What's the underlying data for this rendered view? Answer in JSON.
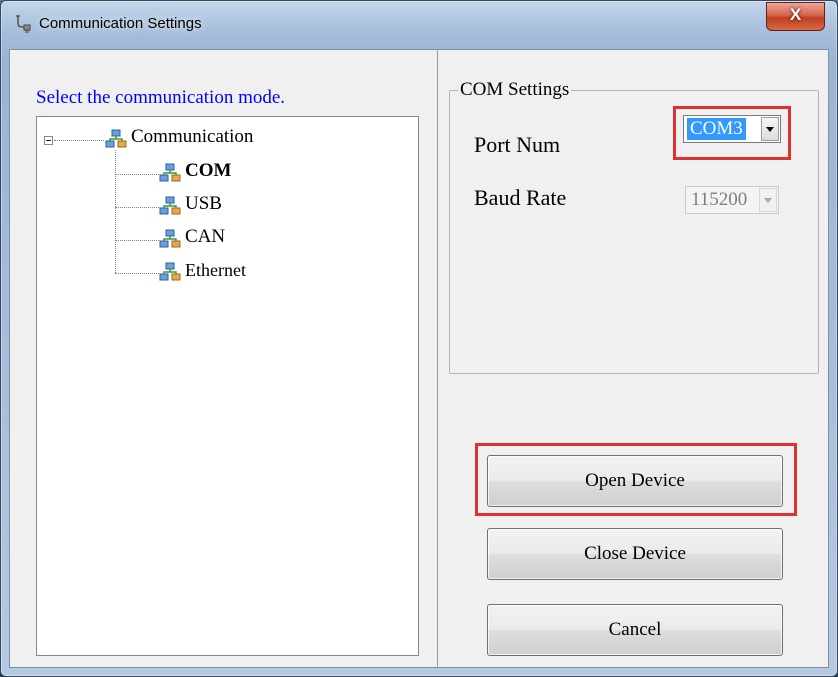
{
  "window": {
    "title": "Communication Settings",
    "close_label": "X"
  },
  "left_panel": {
    "instruction": "Select the communication mode.",
    "tree": {
      "root": "Communication",
      "children": [
        {
          "label": "COM",
          "selected": true
        },
        {
          "label": "USB",
          "selected": false
        },
        {
          "label": "CAN",
          "selected": false
        },
        {
          "label": "Ethernet",
          "selected": false
        }
      ]
    }
  },
  "com_settings": {
    "group_title": "COM Settings",
    "port_label": "Port Num",
    "port_value": "COM3",
    "baud_label": "Baud Rate",
    "baud_value": "115200"
  },
  "buttons": {
    "open": "Open Device",
    "close": "Close Device",
    "cancel": "Cancel"
  },
  "colors": {
    "highlight_box": "#e03030",
    "instruction_text": "#0000ff",
    "selection": "#3399ff"
  },
  "icons": {
    "window": "plug-icon",
    "tree_node": "network-icon"
  }
}
